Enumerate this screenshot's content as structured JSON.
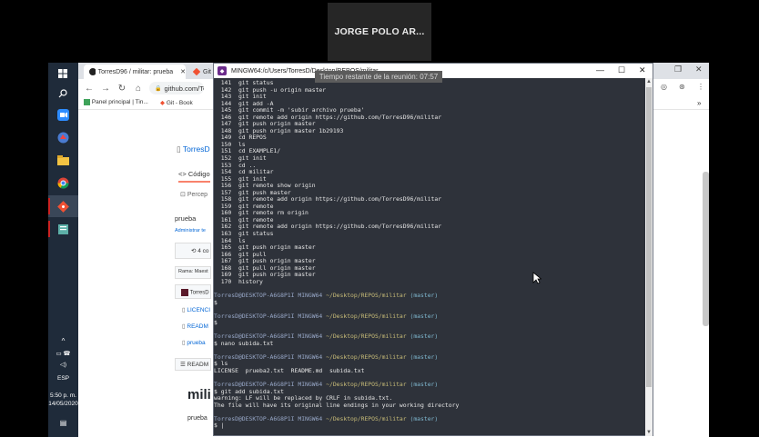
{
  "meeting": {
    "participant_name": "JORGE POLO AR...",
    "time_remaining": "Tiempo restante de la reunión: 07:57"
  },
  "taskbar": {
    "icons": [
      "windows-icon",
      "search-icon",
      "zoom-icon",
      "app-icon",
      "folder-icon",
      "chrome-icon",
      "git-icon",
      "notes-icon"
    ],
    "language": "ESP",
    "time": "5:50 p. m.",
    "date": "14/05/2020"
  },
  "browser": {
    "tabs": [
      {
        "label": "TorresD96 / militar: prueba",
        "icon": "github-icon"
      },
      {
        "label": "Git",
        "icon": "git-icon"
      }
    ],
    "address": "github.com/Torre",
    "bookmarks": [
      "Panel principal | Tin...",
      "Git - Book"
    ]
  },
  "github": {
    "repo": "TorresD",
    "tab_code": "Código",
    "tab_percep": "Percep",
    "description": "prueba",
    "admin": "Administrar te",
    "commits": "4 co",
    "branch": "Rama: Maest",
    "last_commit_user": "TorresD",
    "files": [
      "LICENCI",
      "READM",
      "prueba"
    ],
    "readme_label": "READM",
    "readme_title": "mili",
    "readme_body": "prueba"
  },
  "terminal": {
    "title": "MINGW64:/c/Users/TorresD/Desktop/REPOS/militar",
    "history": [
      {
        "n": "141",
        "cmd": "git status"
      },
      {
        "n": "142",
        "cmd": "git push -u origin master"
      },
      {
        "n": "143",
        "cmd": "git init"
      },
      {
        "n": "144",
        "cmd": "git add -A"
      },
      {
        "n": "145",
        "cmd": "git commit -m 'subir archivo prueba'"
      },
      {
        "n": "146",
        "cmd": "git remote add origin https://github.com/TorresD96/militar"
      },
      {
        "n": "147",
        "cmd": "git push origin master"
      },
      {
        "n": "148",
        "cmd": "git push origin master 1b29193"
      },
      {
        "n": "149",
        "cmd": "cd REPOS"
      },
      {
        "n": "150",
        "cmd": "ls"
      },
      {
        "n": "151",
        "cmd": "cd EXAMPLE1/"
      },
      {
        "n": "152",
        "cmd": "git init"
      },
      {
        "n": "153",
        "cmd": "cd .."
      },
      {
        "n": "154",
        "cmd": "cd militar"
      },
      {
        "n": "155",
        "cmd": "git init"
      },
      {
        "n": "156",
        "cmd": "git remote show origin"
      },
      {
        "n": "157",
        "cmd": "git push master"
      },
      {
        "n": "158",
        "cmd": "git remote add origin https://github.com/TorresD96/militar"
      },
      {
        "n": "159",
        "cmd": "git remote"
      },
      {
        "n": "160",
        "cmd": "git remote rm origin"
      },
      {
        "n": "161",
        "cmd": "git remote"
      },
      {
        "n": "162",
        "cmd": "git remote add origin https://github.com/TorresD96/militar"
      },
      {
        "n": "163",
        "cmd": "git status"
      },
      {
        "n": "164",
        "cmd": "ls"
      },
      {
        "n": "165",
        "cmd": "git push origin master"
      },
      {
        "n": "166",
        "cmd": "git pull"
      },
      {
        "n": "167",
        "cmd": "git push origin master"
      },
      {
        "n": "168",
        "cmd": "git pull origin master"
      },
      {
        "n": "169",
        "cmd": "git push origin master"
      },
      {
        "n": "170",
        "cmd": "history"
      }
    ],
    "prompt_user": "TorresD@DESKTOP-A6G8P1I",
    "prompt_env": "MINGW64",
    "prompt_path": "~/Desktop/REPOS/militar",
    "prompt_branch": "(master)",
    "session": [
      {
        "type": "blank"
      },
      {
        "type": "prompt"
      },
      {
        "type": "input",
        "text": "$"
      },
      {
        "type": "blank"
      },
      {
        "type": "prompt"
      },
      {
        "type": "input",
        "text": "$"
      },
      {
        "type": "blank"
      },
      {
        "type": "prompt"
      },
      {
        "type": "input",
        "text": "$ nano subida.txt"
      },
      {
        "type": "blank"
      },
      {
        "type": "prompt"
      },
      {
        "type": "input",
        "text": "$ ls"
      },
      {
        "type": "output",
        "text": "LICENSE  prueba2.txt  README.md  subida.txt"
      },
      {
        "type": "blank"
      },
      {
        "type": "prompt"
      },
      {
        "type": "input",
        "text": "$ git add subida.txt"
      },
      {
        "type": "output",
        "text": "warning: LF will be replaced by CRLF in subida.txt."
      },
      {
        "type": "output",
        "text": "The file will have its original line endings in your working directory"
      },
      {
        "type": "blank"
      },
      {
        "type": "prompt"
      },
      {
        "type": "input",
        "text": "$ |"
      }
    ]
  }
}
